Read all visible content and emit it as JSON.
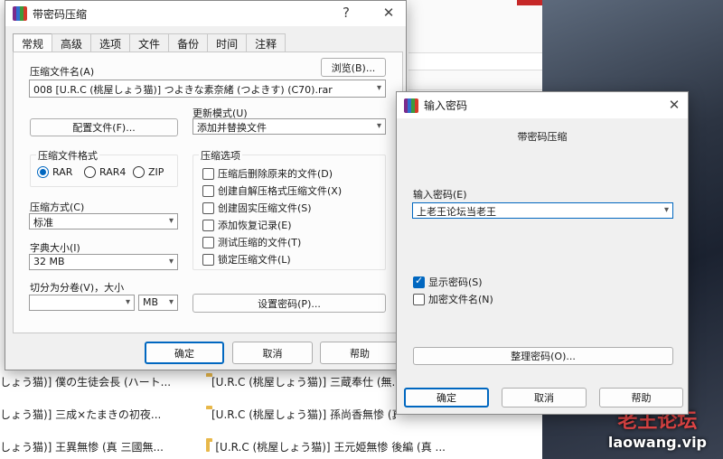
{
  "background": {
    "rows": [
      {
        "left": "しょう猫)] 僕の生徒会長 (ハート...",
        "right": "[U.R.C (桃屋しょう猫)] 三蔵奉仕 (無..."
      },
      {
        "left": "しょう猫)] 三成×たまきの初夜...",
        "right": "[U.R.C (桃屋しょう猫)] 孫尚香無惨 (真..."
      },
      {
        "left": "しょう猫)] 王異無惨 (真 三國無...",
        "right": "[U.R.C (桃屋しょう猫)] 王元姫無惨 後編 (真 ..."
      }
    ],
    "watermark_cn": "老王论坛",
    "watermark_en": "laowang.vip"
  },
  "main_dialog": {
    "title": "带密码压缩",
    "help_glyph": "?",
    "close_glyph": "✕",
    "tabs": [
      "常规",
      "高级",
      "选项",
      "文件",
      "备份",
      "时间",
      "注释"
    ],
    "archive_name_label": "压缩文件名(A)",
    "archive_name_value": "008   [U.R.C (桃屋しょう猫)] つよきな素奈緒 (つよきす) (C70).rar",
    "browse_button": "浏览(B)...",
    "profiles_button": "配置文件(F)...",
    "update_mode_label": "更新模式(U)",
    "update_mode_value": "添加并替换文件",
    "format_group": "压缩文件格式",
    "formats": [
      "RAR",
      "RAR4",
      "ZIP"
    ],
    "method_label": "压缩方式(C)",
    "method_value": "标准",
    "dict_label": "字典大小(I)",
    "dict_value": "32 MB",
    "split_label": "切分为分卷(V)，大小",
    "split_value": "",
    "split_unit": "MB",
    "options_group": "压缩选项",
    "options": [
      {
        "label": "压缩后删除原来的文件(D)",
        "checked": false
      },
      {
        "label": "创建自解压格式压缩文件(X)",
        "checked": false
      },
      {
        "label": "创建固实压缩文件(S)",
        "checked": false
      },
      {
        "label": "添加恢复记录(E)",
        "checked": false
      },
      {
        "label": "测试压缩的文件(T)",
        "checked": false
      },
      {
        "label": "锁定压缩文件(L)",
        "checked": false
      }
    ],
    "set_password_button": "设置密码(P)...",
    "ok_button": "确定",
    "cancel_button": "取消",
    "help_button": "帮助"
  },
  "password_dialog": {
    "title": "输入密码",
    "close_glyph": "✕",
    "heading": "带密码压缩",
    "password_label": "输入密码(E)",
    "password_value": "上老王论坛当老王",
    "show_password_label": "显示密码(S)",
    "show_password_checked": true,
    "encrypt_names_label": "加密文件名(N)",
    "encrypt_names_checked": false,
    "organize_button": "整理密码(O)...",
    "ok_button": "确定",
    "cancel_button": "取消",
    "help_button": "帮助"
  }
}
